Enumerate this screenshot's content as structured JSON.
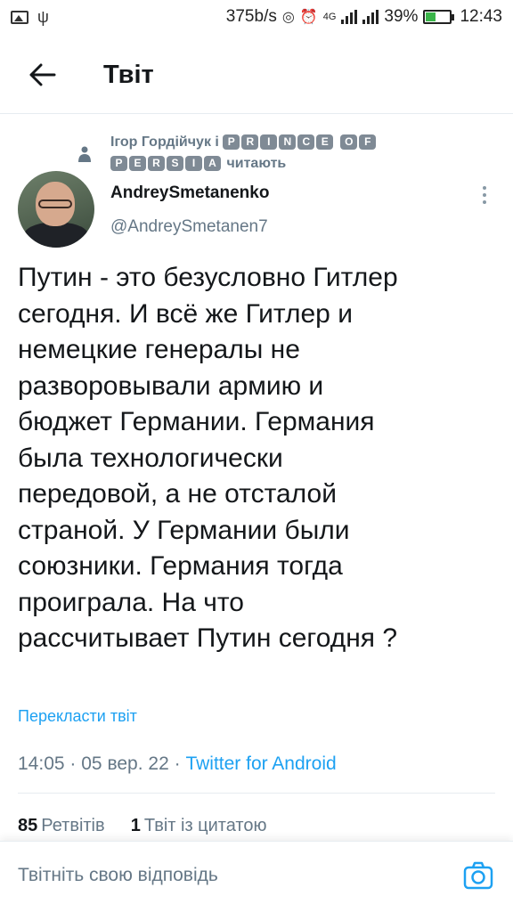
{
  "status_bar": {
    "net_rate": "375b/s",
    "network": "4G",
    "battery": "39%",
    "battery_level": 0.39,
    "time": "12:43",
    "icons": [
      "image-icon",
      "usb-icon",
      "hotspot-icon",
      "alarm-icon",
      "signal-icon",
      "battery-icon"
    ]
  },
  "header": {
    "title": "Твіт",
    "back_icon": "arrow-left-icon"
  },
  "social_context": {
    "prefix": "Ігор Гордійчук і",
    "word1": [
      "P",
      "R",
      "I",
      "N",
      "C",
      "E"
    ],
    "word2": [
      "O",
      "F"
    ],
    "word3": [
      "P",
      "E",
      "R",
      "S",
      "I",
      "A"
    ],
    "suffix": "читають",
    "icon": "person-icon"
  },
  "author": {
    "name": "AndreySmetanenko",
    "handle": "@AndreySmetanen7"
  },
  "tweet": {
    "text": "Путин - это безусловно Гитлер\nсегодня.  И всё же Гитлер и\nнемецкие генералы не\nразворовывали армию и\nбюджет Германии. Германия\nбыла технологически\nпередовой, а не отсталой\nстраной. У Германии были\nсоюзники. Германия тогда\nпроиграла. На что\nрассчитывает Путин сегодня ?",
    "translate_label": "Перекласти твіт",
    "time": "14:05",
    "date": "05 вер. 22",
    "source": "Twitter for Android",
    "separator": "·"
  },
  "stats": {
    "retweets_count": "85",
    "retweets_label": "Ретвітів",
    "quotes_count": "1",
    "quotes_label": "Твіт із цитатою"
  },
  "reply": {
    "placeholder": "Твітніть свою відповідь",
    "camera_icon": "camera-icon"
  },
  "colors": {
    "accent": "#1da1f2",
    "secondary_text": "#657786",
    "primary_text": "#14171a",
    "battery_fill": "#3bb54a"
  }
}
